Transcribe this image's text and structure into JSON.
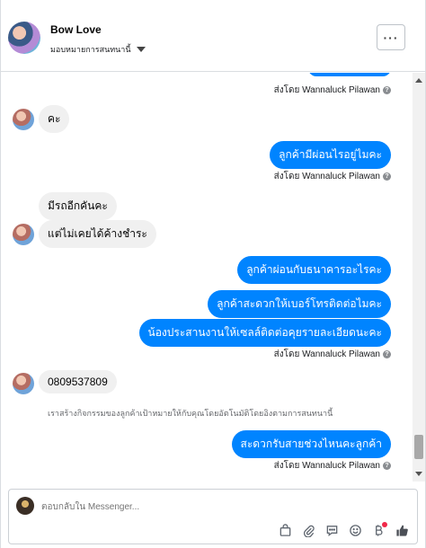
{
  "header": {
    "contact_name": "Bow Love",
    "assign_label": "มอบหมายการสนทนานี้",
    "more_label": "···"
  },
  "messages": {
    "sent_by_1": "ส่งโดย Wannaluck Pilawan",
    "in_1": "คะ",
    "out_1": "ลูกค้ามีผ่อนไรอยู่ไมคะ",
    "sent_by_2": "ส่งโดย Wannaluck Pilawan",
    "in_2": "มีรถอีกคันคะ",
    "in_3": "แต่ไม่เคยได้ค้างชำระ",
    "out_2": "ลูกค้าผ่อนกับธนาคารอะไรคะ",
    "out_3": "ลูกค้าสะดวกให้เบอร์โทรติดต่อไมคะ",
    "out_4": "น้องประสานงานให้เซลล์ติดต่อคุยรายละเอียดนะคะ",
    "sent_by_3": "ส่งโดย Wannaluck Pilawan",
    "in_4": "0809537809",
    "system_note": "เราสร้างกิจกรรมของลูกค้าเป้าหมายให้กับคุณโดยอัตโนมัติโดยอิงตามการสนทนานี้",
    "out_5": "สะดวกรับสายช่วงไหนคะลูกค้า",
    "sent_by_4": "ส่งโดย Wannaluck Pilawan",
    "info_glyph": "?"
  },
  "composer": {
    "placeholder": "ตอบกลับใน Messenger...",
    "icons": [
      "gift-bag-icon",
      "paperclip-icon",
      "saved-replies-icon",
      "emoji-icon",
      "payment-icon",
      "like-icon"
    ]
  },
  "colors": {
    "outgoing_bubble": "#0084ff",
    "incoming_bubble": "#f0f0f0",
    "notification_dot": "#f02849"
  }
}
